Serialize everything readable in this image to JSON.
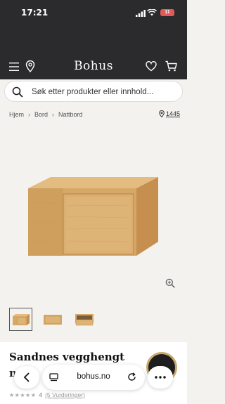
{
  "status_bar": {
    "time": "17:21",
    "battery": "11"
  },
  "header": {
    "brand": "Bohus"
  },
  "search": {
    "placeholder": "Søk etter produkter eller innhold..."
  },
  "breadcrumb": {
    "items": [
      "Hjem",
      "Bord",
      "Nattbord"
    ]
  },
  "store": {
    "number": "1445"
  },
  "product": {
    "title_line1": "Sandnes vegghengt",
    "title_line2": "n",
    "rating_value": "4",
    "reviews": "(5 Vurderinger)"
  },
  "browser": {
    "url": "bohus.no"
  },
  "colors": {
    "header_bg": "#2b2b2e",
    "page_bg": "#f4f2ef",
    "wood": "#d6a867"
  },
  "icons": [
    "menu-icon",
    "location-pin-icon",
    "heart-icon",
    "cart-icon",
    "search-icon",
    "zoom-icon",
    "back-icon",
    "tabs-icon",
    "reload-icon",
    "more-icon"
  ]
}
